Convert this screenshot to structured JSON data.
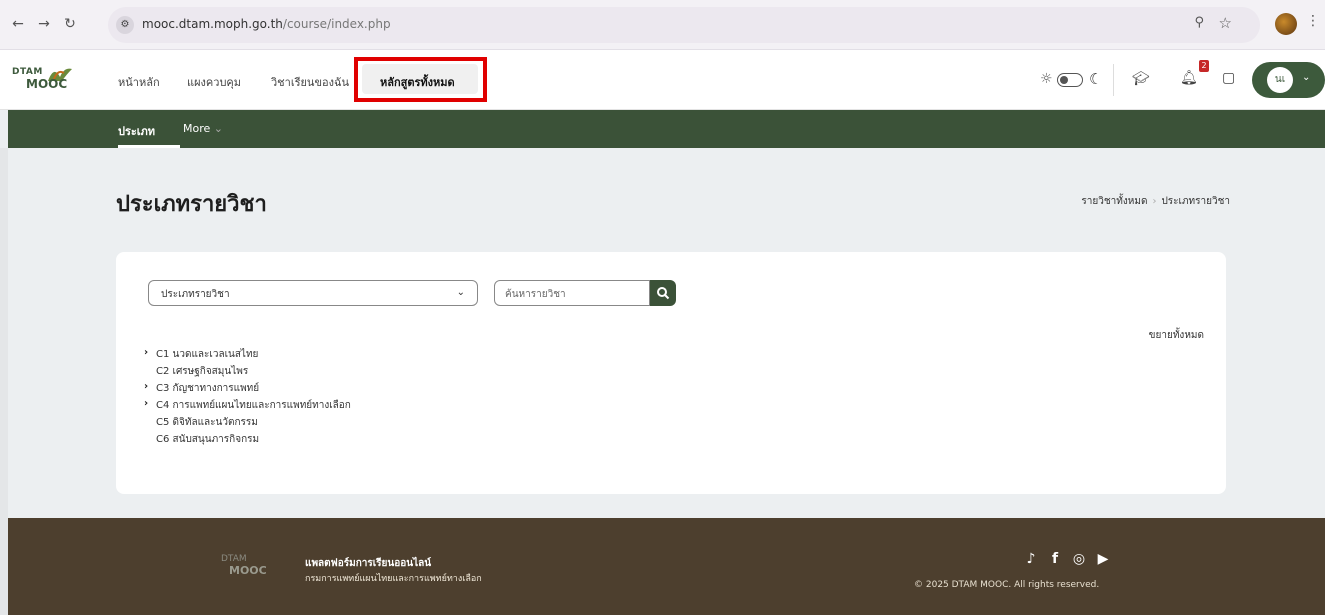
{
  "browser": {
    "url_host": "mooc.dtam.moph.go.th",
    "url_path": "/course/index.php",
    "back_icon": "arrow-left-icon",
    "forward_icon": "arrow-right-icon",
    "reload_icon": "reload-icon"
  },
  "header": {
    "logo_top": "DTAM",
    "logo_bottom": "MOOC",
    "nav": [
      {
        "label": "หน้าหลัก"
      },
      {
        "label": "แผงควบคุม"
      },
      {
        "label": "วิชาเรียนของฉัน"
      },
      {
        "label": "หลักสูตรทั้งหมด"
      }
    ],
    "notification_count": "2",
    "user_initials": "นเ"
  },
  "subnav": {
    "items": [
      {
        "label": "ประเภท"
      },
      {
        "label": "More"
      }
    ]
  },
  "main": {
    "title": "ประเภทรายวิชา",
    "breadcrumb": [
      "รายวิชาทั้งหมด",
      "ประเภทรายวิชา"
    ],
    "select_value": "ประเภทรายวิชา",
    "search_placeholder": "ค้นหารายวิชา",
    "expand_all": "ขยายทั้งหมด",
    "categories": [
      {
        "label": "C1 นวดและเวลเนสไทย",
        "expandable": true
      },
      {
        "label": "C2 เศรษฐกิจสมุนไพร",
        "expandable": false
      },
      {
        "label": "C3 กัญชาทางการแพทย์",
        "expandable": true
      },
      {
        "label": "C4 การแพทย์แผนไทยและการแพทย์ทางเลือก",
        "expandable": true
      },
      {
        "label": "C5 ดิจิทัลและนวัตกรรม",
        "expandable": false
      },
      {
        "label": "C6 สนับสนุนภารกิจกรม",
        "expandable": false
      }
    ]
  },
  "footer": {
    "logo_top": "DTAM",
    "logo_bottom": "MOOC",
    "title": "แพลตฟอร์มการเรียนออนไลน์",
    "subtitle": "กรมการแพทย์แผนไทยและการแพทย์ทางเลือก",
    "copyright": "© 2025 DTAM MOOC. All rights reserved.",
    "socials": [
      "tiktok-icon",
      "facebook-icon",
      "instagram-icon",
      "youtube-icon"
    ]
  },
  "colors": {
    "brand_green": "#3b5238",
    "footer_brown": "#4d3f2e",
    "highlight_red": "#e00000"
  }
}
